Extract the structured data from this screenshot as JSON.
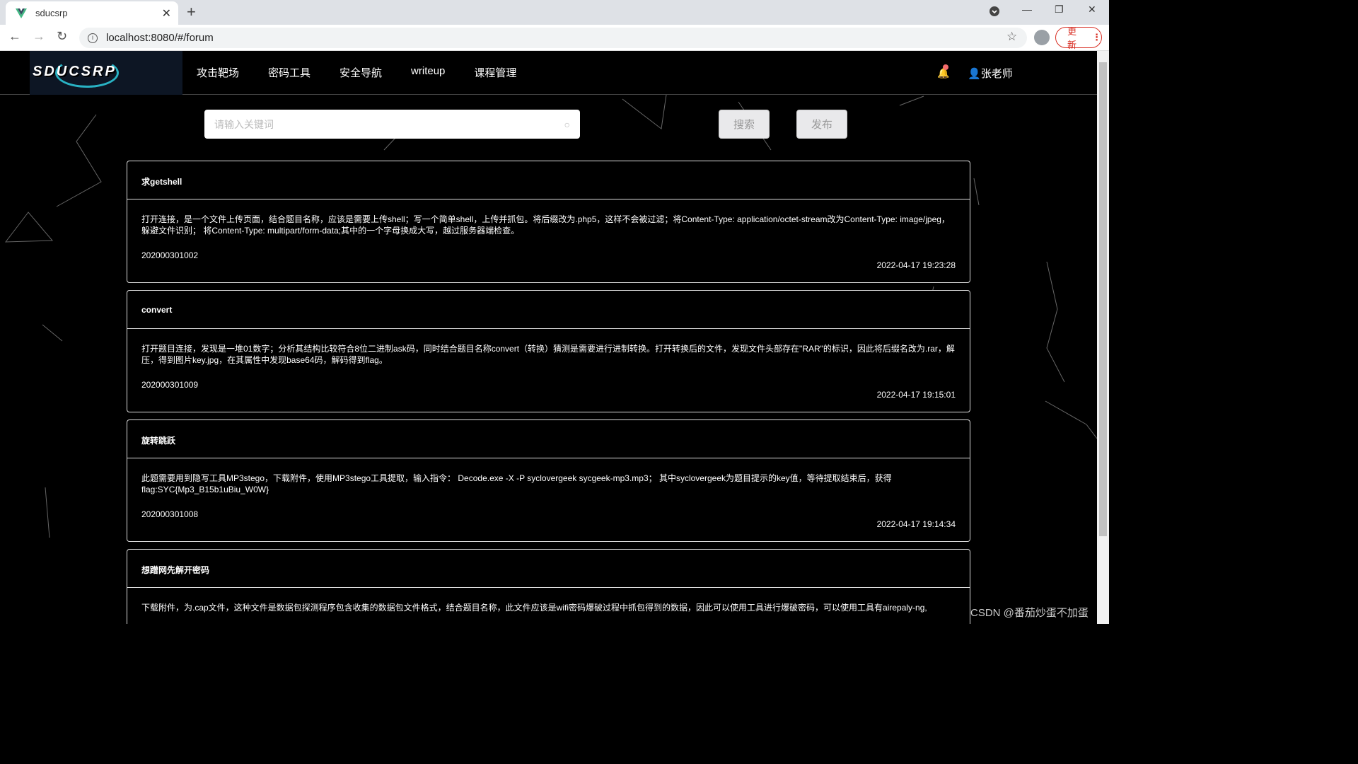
{
  "browser": {
    "tab_title": "sducsrp",
    "url": "localhost:8080/#/forum",
    "update_label": "更新"
  },
  "site": {
    "logo_text": "SDUCSRP",
    "menu": [
      "攻击靶场",
      "密码工具",
      "安全导航",
      "writeup",
      "课程管理"
    ],
    "user_name": "张老师",
    "search_placeholder": "请输入关键词",
    "search_button": "搜索",
    "publish_button": "发布"
  },
  "posts": [
    {
      "title": "求getshell",
      "content": "打开连接，是一个文件上传页面，结合题目名称，应该是需要上传shell；写一个简单shell，上传并抓包。将后缀改为.php5，这样不会被过滤；将Content-Type: application/octet-stream改为Content-Type: image/jpeg，躲避文件识别； 将Content-Type: multipart/form-data;其中的一个字母换成大写，越过服务器端检查。",
      "author": "202000301002",
      "time": "2022-04-17 19:23:28"
    },
    {
      "title": "convert",
      "content": "打开题目连接，发现是一堆01数字；分析其结构比较符合8位二进制ask码，同时结合题目名称convert（转换）猜测是需要进行进制转换。打开转换后的文件，发现文件头部存在\"RAR\"的标识，因此将后缀名改为.rar，解压，得到图片key.jpg，在其属性中发现base64码，解码得到flag。",
      "author": "202000301009",
      "time": "2022-04-17 19:15:01"
    },
    {
      "title": "旋转跳跃",
      "content": "此题需要用到隐写工具MP3stego，下载附件，使用MP3stego工具提取，输入指令： Decode.exe -X -P syclovergeek sycgeek-mp3.mp3； 其中syclovergeek为题目提示的key值，等待提取结束后，获得flag:SYC{Mp3_B15b1uBiu_W0W}",
      "author": "202000301008",
      "time": "2022-04-17 19:14:34"
    },
    {
      "title": "想蹭网先解开密码",
      "content": "下载附件，为.cap文件，这种文件是数据包探测程序包含收集的数据包文件格式，结合题目名称，此文件应该是wifi密码爆破过程中抓包得到的数据，因此可以使用工具进行爆破密码，可以使用工具有airepaly-ng,",
      "author": "",
      "time": ""
    }
  ],
  "watermark": "CSDN @番茄炒蛋不加蛋"
}
